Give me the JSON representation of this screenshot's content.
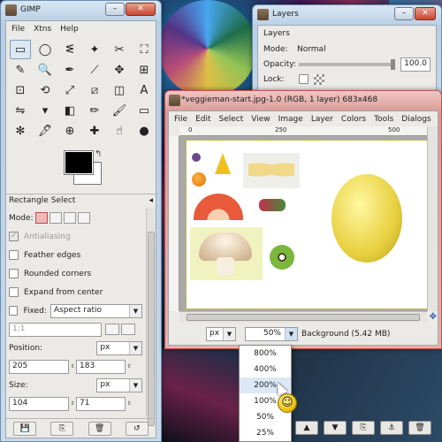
{
  "toolbox": {
    "title": "GIMP",
    "menu": [
      "File",
      "Xtns",
      "Help"
    ],
    "tools": [
      "rect-select-icon",
      "ellipse-select-icon",
      "lasso-icon",
      "fuzzy-select-icon",
      "scissors-icon",
      "fg-select-icon",
      "color-picker-icon",
      "zoom-icon",
      "paths-icon",
      "measure-icon",
      "move-icon",
      "align-icon",
      "crop-icon",
      "rotate-icon",
      "scale-icon",
      "shear-icon",
      "perspective-icon",
      "text-icon",
      "flip-icon",
      "bucket-fill-icon",
      "blend-icon",
      "pencil-icon",
      "paintbrush-icon",
      "eraser-icon",
      "airbrush-icon",
      "ink-icon",
      "clone-icon",
      "heal-icon",
      "smudge-icon",
      "dodge-icon"
    ],
    "tool_glyphs": [
      "▭",
      "◯",
      "ᓬ",
      "✦",
      "✂",
      "⛶",
      "✎",
      "🔍",
      "✒",
      "⟋",
      "✥",
      "⊞",
      "⊡",
      "⟲",
      "⤢",
      "⧄",
      "◫",
      "A",
      "⇋",
      "▾",
      "◧",
      "✏",
      "🖌",
      "▭",
      "✻",
      "🖋",
      "⊕",
      "✚",
      "☝",
      "●"
    ],
    "options": {
      "title": "Rectangle Select",
      "mode_label": "Mode:",
      "antialiasing": "Antialiasing",
      "feather": "Feather edges",
      "rounded": "Rounded corners",
      "expand": "Expand from center",
      "fixed": "Fixed:",
      "fixed_value": "Aspect ratio",
      "ratio": "1:1",
      "position_label": "Position:",
      "position_unit": "px",
      "pos_x": "205",
      "pos_y": "183",
      "size_label": "Size:",
      "size_unit": "px",
      "size_w": "104",
      "size_h": "71"
    }
  },
  "layers": {
    "title": "Layers",
    "header": "Layers",
    "mode_label": "Mode:",
    "mode_value": "Normal",
    "opacity_label": "Opacity:",
    "opacity_value": "100.0",
    "lock_label": "Lock:"
  },
  "image_window": {
    "title": "*veggieman-start.jpg-1.0 (RGB, 1 layer) 683x468",
    "menu": [
      "File",
      "Edit",
      "Select",
      "View",
      "Image",
      "Layer",
      "Colors",
      "Tools",
      "Dialogs"
    ],
    "ruler_marks": [
      "0",
      "250",
      "500"
    ],
    "unit": "px",
    "zoom": "50%",
    "status": "Background (5.42 MB)"
  },
  "zoom_menu": {
    "options": [
      "800%",
      "400%",
      "200%",
      "100%",
      "50%",
      "25%"
    ]
  },
  "colors": {
    "fg": "#000000",
    "bg": "#ffffff",
    "accent": "#c85050"
  }
}
